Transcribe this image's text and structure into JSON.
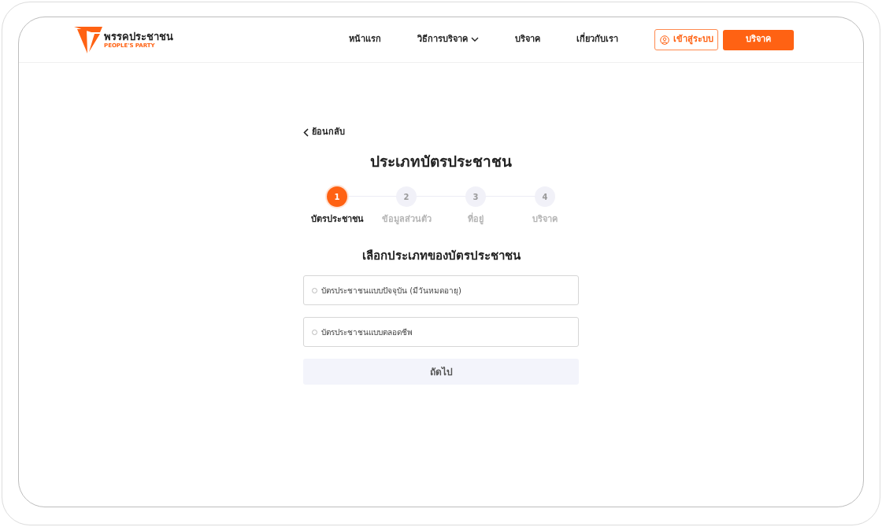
{
  "header": {
    "logo": {
      "name": "พรรคประชาชน",
      "subtitle": "PEOPLE'S PARTY"
    },
    "nav": [
      {
        "label": "หน้าแรก",
        "kind": "link"
      },
      {
        "label": "วิธีการบริจาค",
        "kind": "dropdown"
      },
      {
        "label": "บริจาค",
        "kind": "link"
      },
      {
        "label": "เกี่ยวกับเรา",
        "kind": "link"
      }
    ],
    "login_button": "เข้าสู่ระบบ",
    "donate_button": "บริจาค"
  },
  "back": "ย้อนกลับ",
  "title": "ประเภทบัตรประชาชน",
  "steps": [
    {
      "number": "1",
      "label": "บัตรประชาชน",
      "selected": true
    },
    {
      "number": "2",
      "label": "ข้อมูลส่วนตัว",
      "selected": false
    },
    {
      "number": "3",
      "label": "ที่อยู่",
      "selected": false
    },
    {
      "number": "4",
      "label": "บริจาค",
      "selected": false
    }
  ],
  "question": "เลือกประเภทของบัตรประชาชน",
  "options": [
    {
      "label": "บัตรประชาชนแบบปัจจุบัน (มีวันหมดอายุ)",
      "selected": false
    },
    {
      "label": "บัตรประชาชนแบบตลอดชีพ",
      "selected": false
    }
  ],
  "next_button": {
    "label": "ถัดไป",
    "disabled": true
  }
}
